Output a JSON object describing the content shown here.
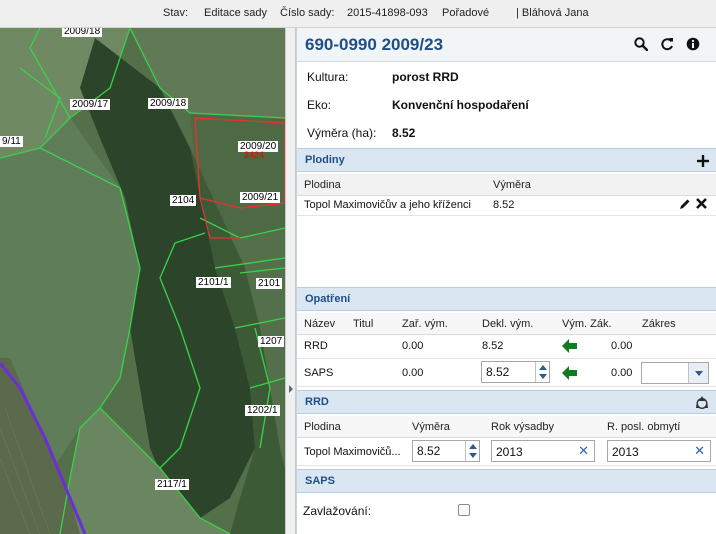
{
  "statusbar": {
    "stav_label": "Stav:",
    "stav_value": "Editace sady",
    "cislo_label": "Číslo sady:",
    "cislo_value": "2015-41898-093",
    "poradove_label": "Pořadové",
    "user": "| Bláhová Jana"
  },
  "map": {
    "parcel_labels": [
      "2009/18",
      "2009/17",
      "2009/18",
      "9/11",
      "2009/20",
      "2104",
      "2009/21",
      "2101/1",
      "2101",
      "1207",
      "1202/1",
      "2117/1"
    ],
    "red_label": "2424"
  },
  "panel": {
    "title": "690-0990 2009/23",
    "icons": [
      "search-icon",
      "refresh-icon",
      "info-icon"
    ],
    "info": {
      "kultura_label": "Kultura:",
      "kultura_value": "porost RRD",
      "eko_label": "Eko:",
      "eko_value": "Konvenční hospodaření",
      "vymera_label": "Výměra (ha):",
      "vymera_value": "8.52"
    }
  },
  "plodiny": {
    "title": "Plodiny",
    "add_icon": "plus-icon",
    "columns": [
      "Plodina",
      "Výměra"
    ],
    "rows": [
      {
        "plodina": "Topol Maximovičův a jeho kříženci",
        "vymera": "8.52"
      }
    ]
  },
  "opatreni": {
    "title": "Opatření",
    "columns": [
      "Název",
      "Titul",
      "Zař. vým.",
      "Dekl. vým.",
      "Vým. Zák.",
      "Zákres"
    ],
    "rows": [
      {
        "nazev": "RRD",
        "titul": "",
        "zar": "0.00",
        "dekl": "8.52",
        "vym_zak": "0.00",
        "zakres": ""
      },
      {
        "nazev": "SAPS",
        "titul": "",
        "zar": "0.00",
        "dekl": "8.52",
        "vym_zak": "0.00",
        "zakres": ""
      }
    ]
  },
  "rrd": {
    "title": "RRD",
    "recycle_icon": "recycle-icon",
    "columns": [
      "Plodina",
      "Výměra",
      "Rok výsadby",
      "R. posl. obmytí"
    ],
    "row": {
      "plodina": "Topol Maximovičů...",
      "vymera": "8.52",
      "rok_vysadby": "2013",
      "r_posl_obmyti": "2013"
    }
  },
  "saps": {
    "title": "SAPS",
    "zavlazovani_label": "Zavlažování:",
    "zavlazovani_checked": false
  },
  "colors": {
    "accent": "#1f4f87",
    "section_bg": "#dbe6f3",
    "arrow_green": "#0d7d1e"
  }
}
